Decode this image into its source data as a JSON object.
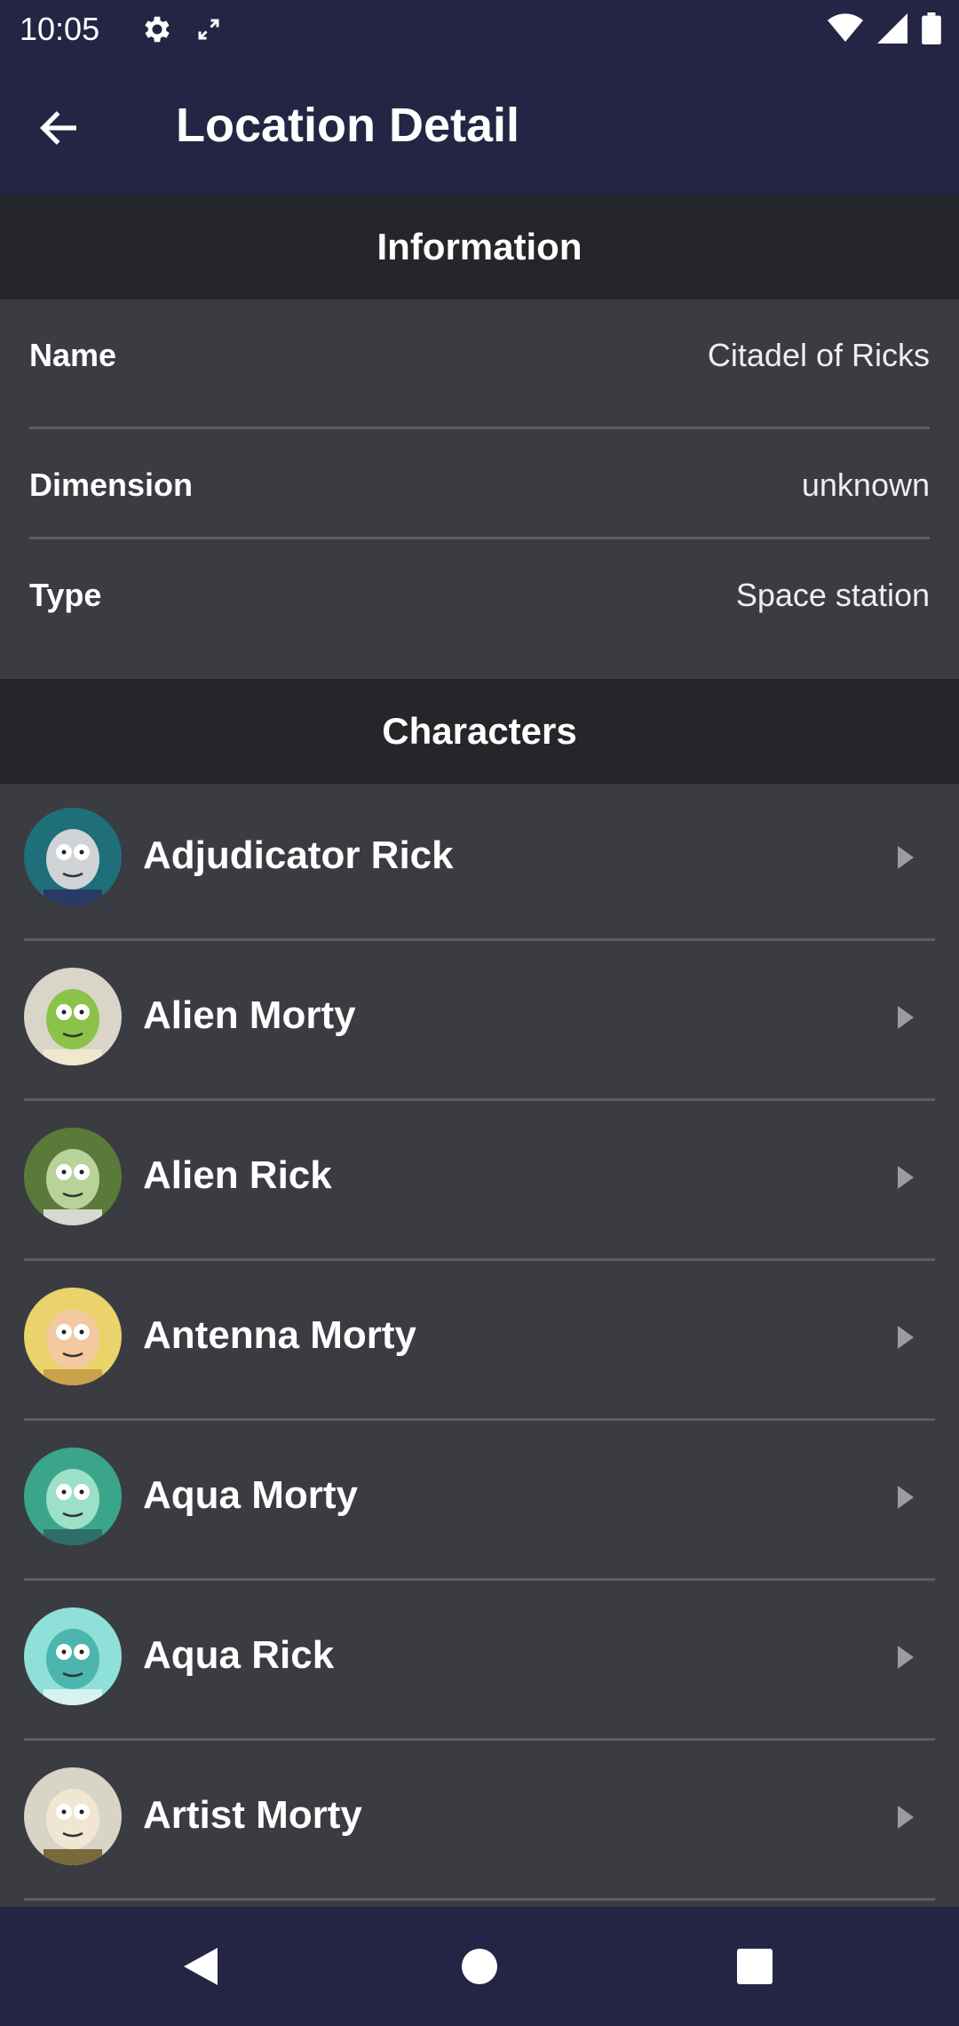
{
  "status_bar": {
    "time": "10:05",
    "icons": [
      "gear-icon",
      "sync-icon",
      "wifi-icon",
      "signal-icon",
      "battery-icon"
    ]
  },
  "app_bar": {
    "title": "Location Detail",
    "back_icon": "arrow-left-icon"
  },
  "information": {
    "header": "Information",
    "rows": [
      {
        "label": "Name",
        "value": "Citadel of Ricks"
      },
      {
        "label": "Dimension",
        "value": "unknown"
      },
      {
        "label": "Type",
        "value": "Space station"
      }
    ]
  },
  "characters": {
    "header": "Characters",
    "items": [
      {
        "name": "Adjudicator Rick",
        "avatar_colors": [
          "#1f6f7a",
          "#cfd3d6",
          "#2a3a66"
        ]
      },
      {
        "name": "Alien Morty",
        "avatar_colors": [
          "#d9d6c9",
          "#8bc34a",
          "#f0e7cf"
        ]
      },
      {
        "name": "Alien Rick",
        "avatar_colors": [
          "#5a7a3a",
          "#b7d39a",
          "#d6d9cf"
        ]
      },
      {
        "name": "Antenna Morty",
        "avatar_colors": [
          "#e9d36a",
          "#f3c9a0",
          "#c9a24b"
        ]
      },
      {
        "name": "Aqua Morty",
        "avatar_colors": [
          "#3aa58a",
          "#9be0c7",
          "#2d6e6a"
        ]
      },
      {
        "name": "Aqua Rick",
        "avatar_colors": [
          "#8fe0d8",
          "#4cb5ae",
          "#d7f3f0"
        ]
      },
      {
        "name": "Artist Morty",
        "avatar_colors": [
          "#d8d4c6",
          "#f1e6d2",
          "#7a6a3a"
        ]
      }
    ]
  },
  "nav_bar": {
    "icons": [
      "back-triangle-icon",
      "home-circle-icon",
      "recents-square-icon"
    ]
  },
  "colors": {
    "bar_bg": "#242544",
    "section_header_bg": "#242629",
    "panel_bg": "#3a3c42",
    "divider": "#5c5e64",
    "text": "#ffffff"
  }
}
